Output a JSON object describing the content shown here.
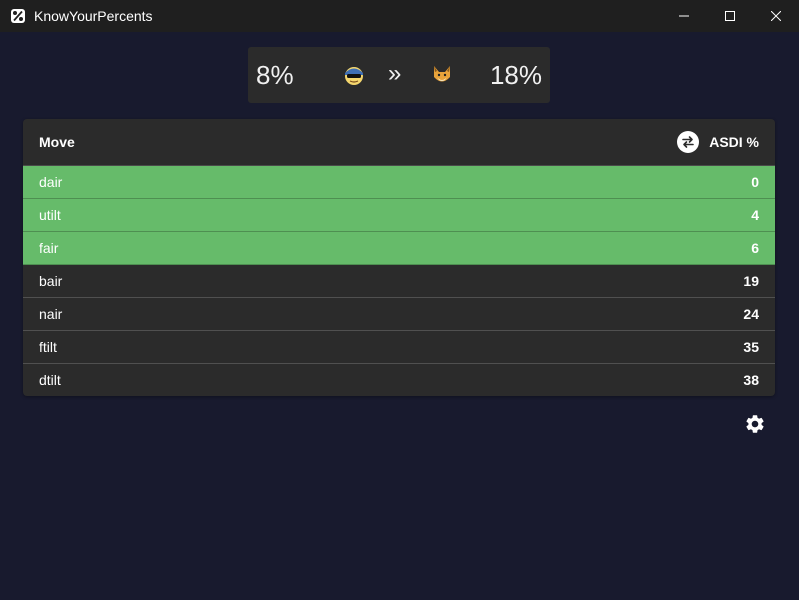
{
  "window": {
    "title": "KnowYourPercents"
  },
  "header": {
    "left_percent": "8%",
    "separator": "»",
    "right_percent": "18%",
    "left_character_icon": "attacker-character-icon",
    "right_character_icon": "target-character-icon"
  },
  "table": {
    "col_move": "Move",
    "col_asdi": "ASDI %",
    "swap_icon": "swap-icon",
    "rows": [
      {
        "move": "dair",
        "value": "0",
        "highlighted": true
      },
      {
        "move": "utilt",
        "value": "4",
        "highlighted": true
      },
      {
        "move": "fair",
        "value": "6",
        "highlighted": true
      },
      {
        "move": "bair",
        "value": "19",
        "highlighted": false
      },
      {
        "move": "nair",
        "value": "24",
        "highlighted": false
      },
      {
        "move": "ftilt",
        "value": "35",
        "highlighted": false
      },
      {
        "move": "dtilt",
        "value": "38",
        "highlighted": false
      }
    ]
  },
  "colors": {
    "background": "#181a2e",
    "card": "#2b2b2b",
    "highlight": "#66bb6a",
    "titlebar": "#1f1f1f"
  },
  "settings_icon": "gear-icon"
}
